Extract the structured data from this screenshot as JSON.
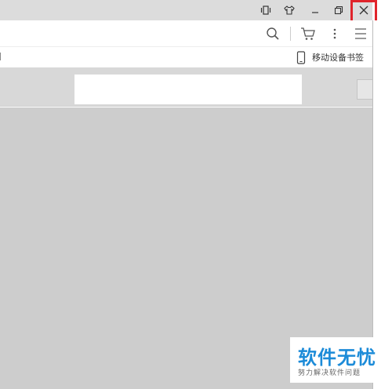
{
  "window": {
    "controls": [
      "vibrate-icon",
      "skin-icon",
      "minimize-icon",
      "restore-icon",
      "close-icon"
    ]
  },
  "toolbar": {
    "icons": [
      "search-icon",
      "cart-icon",
      "more-icon",
      "menu-icon"
    ]
  },
  "bookmarks": {
    "mobile_label": "移动设备书签"
  },
  "watermark": {
    "title": "软件无忧",
    "subtitle": "努力解决软件问题"
  },
  "colors": {
    "highlight": "#e0242b",
    "watermark_blue": "#1c8bd8"
  }
}
